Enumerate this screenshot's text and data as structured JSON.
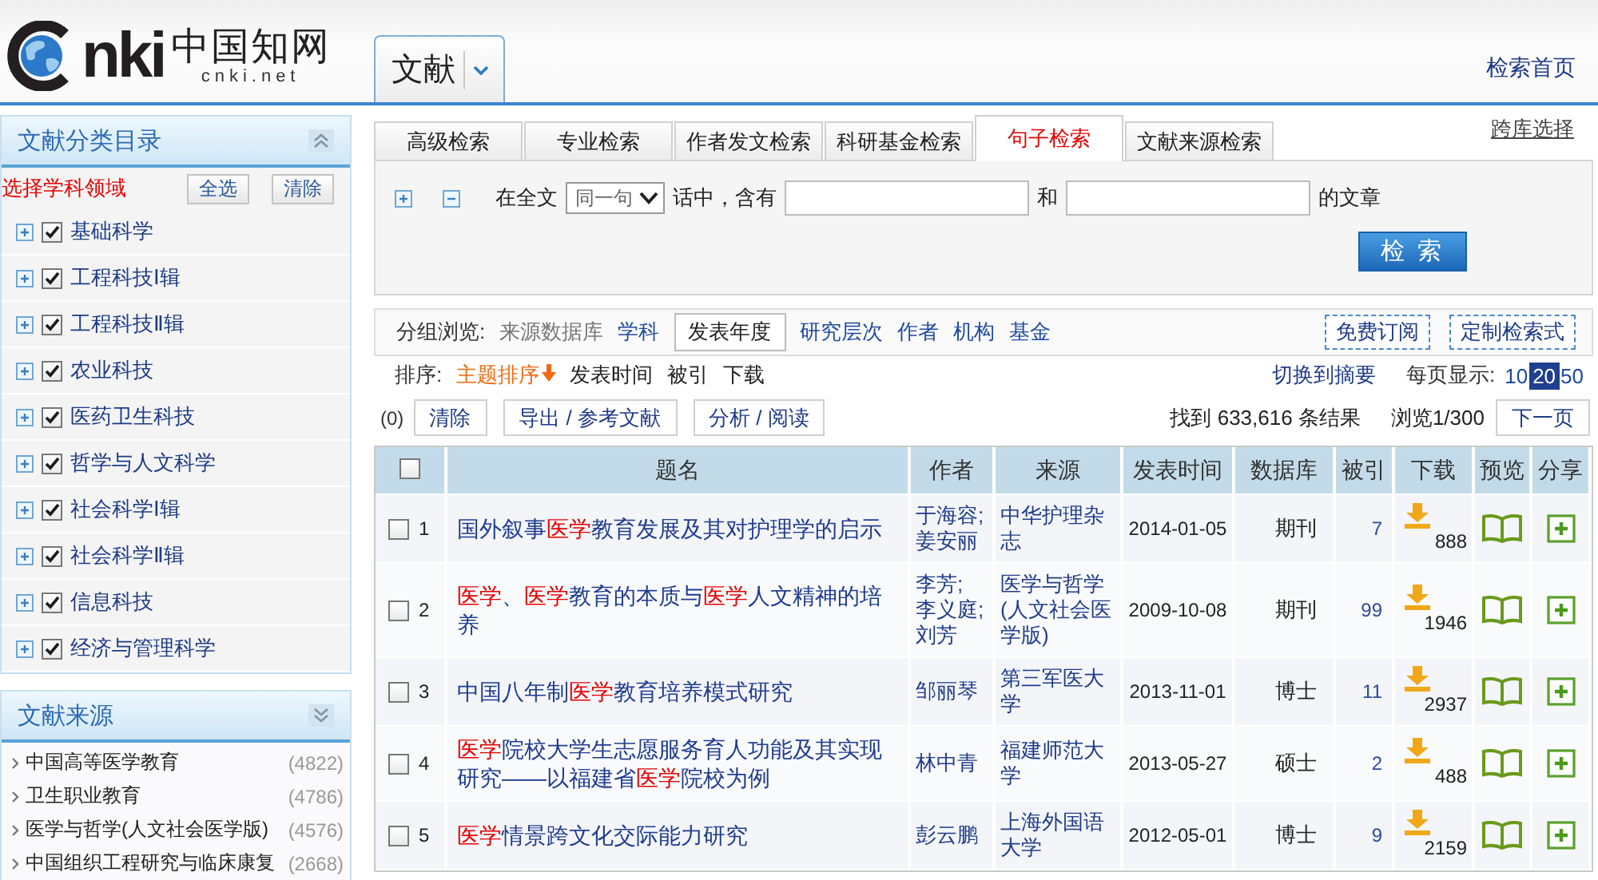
{
  "header": {
    "logo": {
      "wordmark": "nki",
      "name": "中国知网",
      "domain": "cnki.net"
    },
    "database_selector": "文献",
    "home_link": "检索首页"
  },
  "sidebar": {
    "subject_panel": {
      "title": "文献分类目录",
      "prompt": "选择学科领域",
      "buttons": [
        "全选",
        "清除"
      ],
      "items": [
        {
          "label": "基础科学",
          "checked": true,
          "expanded": false
        },
        {
          "label": "工程科技Ⅰ辑",
          "checked": true,
          "expanded": false
        },
        {
          "label": "工程科技Ⅱ辑",
          "checked": true,
          "expanded": false
        },
        {
          "label": "农业科技",
          "checked": true,
          "expanded": false
        },
        {
          "label": "医药卫生科技",
          "checked": true,
          "expanded": false
        },
        {
          "label": "哲学与人文科学",
          "checked": true,
          "expanded": false
        },
        {
          "label": "社会科学Ⅰ辑",
          "checked": true,
          "expanded": false
        },
        {
          "label": "社会科学Ⅱ辑",
          "checked": true,
          "expanded": false
        },
        {
          "label": "信息科技",
          "checked": true,
          "expanded": false
        },
        {
          "label": "经济与管理科学",
          "checked": true,
          "expanded": false
        }
      ]
    },
    "source_panel": {
      "title": "文献来源",
      "items": [
        {
          "label": "中国高等医学教育",
          "count": "(4822)"
        },
        {
          "label": "卫生职业教育",
          "count": "(4786)"
        },
        {
          "label": "医学与哲学(人文社会医学版)",
          "count": "(4576)"
        },
        {
          "label": "中国组织工程研究与临床康复",
          "count": "(2668)"
        }
      ]
    }
  },
  "search": {
    "cross_db_link": "跨库选择",
    "tabs": [
      {
        "label": "高级检索",
        "selected": false
      },
      {
        "label": "专业检索",
        "selected": false
      },
      {
        "label": "作者发文检索",
        "selected": false
      },
      {
        "label": "科研基金检索",
        "selected": false
      },
      {
        "label": "句子检索",
        "selected": true
      },
      {
        "label": "文献来源检索",
        "selected": false
      }
    ],
    "form": {
      "parts": [
        {
          "kind": "label",
          "text": "在全文"
        },
        {
          "kind": "select",
          "value": "同一句"
        },
        {
          "kind": "label",
          "text": "话中，含有"
        },
        {
          "kind": "input"
        },
        {
          "kind": "label",
          "text": "和"
        },
        {
          "kind": "input"
        },
        {
          "kind": "label",
          "text": "的文章"
        }
      ],
      "submit": "检 索"
    }
  },
  "results": {
    "group_browse": {
      "label": "分组浏览:",
      "items": [
        {
          "label": "来源数据库",
          "selected": false,
          "disabled": true
        },
        {
          "label": "学科",
          "selected": false,
          "disabled": false
        },
        {
          "label": "发表年度",
          "selected": true,
          "disabled": false
        },
        {
          "label": "研究层次",
          "selected": false,
          "disabled": false
        },
        {
          "label": "作者",
          "selected": false,
          "disabled": false
        },
        {
          "label": "机构",
          "selected": false,
          "disabled": false
        },
        {
          "label": "基金",
          "selected": false,
          "disabled": false
        }
      ]
    },
    "actions": [
      "免费订阅",
      "定制检索式"
    ],
    "sort": {
      "label": "排序:",
      "items": [
        {
          "label": "主题排序",
          "selected": true
        },
        {
          "label": "发表时间",
          "selected": false
        },
        {
          "label": "被引",
          "selected": false
        },
        {
          "label": "下载",
          "selected": false
        }
      ]
    },
    "view_toggle": "切换到摘要",
    "page_size": {
      "label": "每页显示:",
      "options": [
        {
          "label": "10",
          "selected": false
        },
        {
          "label": "20",
          "selected": true
        },
        {
          "label": "50",
          "selected": false
        }
      ]
    },
    "selection_count": "(0)",
    "toolbar_buttons": [
      "清除",
      "导出 / 参考文献",
      "分析 / 阅读"
    ],
    "result_count": "找到 633,616 条结果",
    "page_info": "浏览1/300",
    "next_page": "下一页",
    "table": {
      "all_checked": false,
      "columns": [
        "题名",
        "作者",
        "来源",
        "发表时间",
        "数据库",
        "被引",
        "下载",
        "预览",
        "分享"
      ],
      "rows": [
        {
          "checked": false,
          "index": "1",
          "title": [
            {
              "text": "国外叙事",
              "highlight": false
            },
            {
              "text": "医学",
              "highlight": true
            },
            {
              "text": "教育发展及其对护理学的启示",
              "highlight": false
            }
          ],
          "authors": "于海容; 姜安丽",
          "source": "中华护理杂志",
          "date": "2014-01-05",
          "database": "期刊",
          "cited": "7",
          "downloads": "888"
        },
        {
          "checked": false,
          "index": "2",
          "title": [
            {
              "text": "医学",
              "highlight": true
            },
            {
              "text": "、",
              "highlight": false
            },
            {
              "text": "医学",
              "highlight": true
            },
            {
              "text": "教育的本质与",
              "highlight": false
            },
            {
              "text": "医学",
              "highlight": true
            },
            {
              "text": "人文精神的培养",
              "highlight": false
            }
          ],
          "authors": "李芳; 李义庭; 刘芳",
          "source": "医学与哲学(人文社会医学版)",
          "date": "2009-10-08",
          "database": "期刊",
          "cited": "99",
          "downloads": "1946"
        },
        {
          "checked": false,
          "index": "3",
          "title": [
            {
              "text": "中国八年制",
              "highlight": false
            },
            {
              "text": "医学",
              "highlight": true
            },
            {
              "text": "教育培养模式研究",
              "highlight": false
            }
          ],
          "authors": "邹丽琴",
          "source": "第三军医大学",
          "date": "2013-11-01",
          "database": "博士",
          "cited": "11",
          "downloads": "2937"
        },
        {
          "checked": false,
          "index": "4",
          "title": [
            {
              "text": "医学",
              "highlight": true
            },
            {
              "text": "院校大学生志愿服务育人功能及其实现研究——以福建省",
              "highlight": false
            },
            {
              "text": "医学",
              "highlight": true
            },
            {
              "text": "院校为例",
              "highlight": false
            }
          ],
          "authors": "林中青",
          "source": "福建师范大学",
          "date": "2013-05-27",
          "database": "硕士",
          "cited": "2",
          "downloads": "488"
        },
        {
          "checked": false,
          "index": "5",
          "title": [
            {
              "text": "医学",
              "highlight": true
            },
            {
              "text": "情景跨文化交际能力研究",
              "highlight": false
            }
          ],
          "authors": "彭云鹏",
          "source": "上海外国语大学",
          "date": "2012-05-01",
          "database": "博士",
          "cited": "9",
          "downloads": "2159"
        }
      ]
    }
  }
}
